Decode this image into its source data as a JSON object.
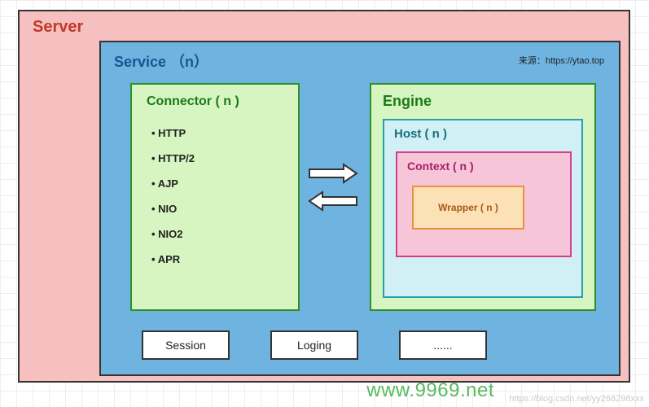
{
  "server": {
    "title": "Server"
  },
  "service": {
    "title": "Service （n）",
    "source": "来源：https://ytao.top"
  },
  "connector": {
    "title": "Connector ( n )",
    "protocols": [
      "HTTP",
      "HTTP/2",
      "AJP",
      "NIO",
      "NIO2",
      "APR"
    ]
  },
  "engine": {
    "title": "Engine"
  },
  "host": {
    "title": "Host ( n )"
  },
  "context": {
    "title": "Context ( n )"
  },
  "wrapper": {
    "title": "Wrapper ( n )"
  },
  "bottom": {
    "session": "Session",
    "loging": "Loging",
    "more": "......"
  },
  "watermark": "www.9969.net",
  "faded_url": "https://blog.csdn.net/yy268298xxx"
}
